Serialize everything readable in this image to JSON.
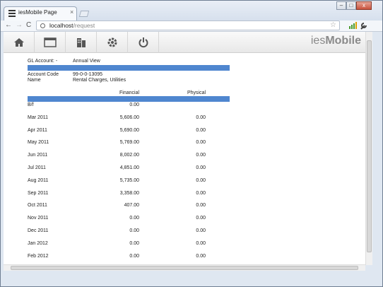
{
  "browser": {
    "tab_title": "iesMobile Page",
    "tab_close": "×",
    "window_controls": {
      "minimize": "–",
      "maximize": "□",
      "close": "x"
    },
    "url_host": "localhost",
    "url_path": "/request",
    "nav": {
      "back": "←",
      "forward": "→",
      "reload": "C"
    },
    "star": "☆"
  },
  "app": {
    "brand_prefix": "ies",
    "brand_suffix": "Mobile"
  },
  "report": {
    "gl_label": "GL Account: -",
    "gl_view": "Annual View",
    "account_code_label": "Account Code",
    "account_code": "99-0-0-13095",
    "name_label": "Name",
    "name": "Rental Charges, Utilities",
    "col_financial": "Financial",
    "col_physical": "Physical",
    "rows": [
      {
        "period": "B/f",
        "financial": "0.00",
        "physical": ""
      },
      {
        "period": "Mar 2011",
        "financial": "5,606.00",
        "physical": "0.00"
      },
      {
        "period": "Apr 2011",
        "financial": "5,690.00",
        "physical": "0.00"
      },
      {
        "period": "May 2011",
        "financial": "5,769.00",
        "physical": "0.00"
      },
      {
        "period": "Jun 2011",
        "financial": "8,002.00",
        "physical": "0.00"
      },
      {
        "period": "Jul 2011",
        "financial": "4,851.00",
        "physical": "0.00"
      },
      {
        "period": "Aug 2011",
        "financial": "5,735.00",
        "physical": "0.00"
      },
      {
        "period": "Sep 2011",
        "financial": "3,358.00",
        "physical": "0.00"
      },
      {
        "period": "Oct 2011",
        "financial": "407.00",
        "physical": "0.00"
      },
      {
        "period": "Nov 2011",
        "financial": "0.00",
        "physical": "0.00"
      },
      {
        "period": "Dec 2011",
        "financial": "0.00",
        "physical": "0.00"
      },
      {
        "period": "Jan 2012",
        "financial": "0.00",
        "physical": "0.00"
      },
      {
        "period": "Feb 2012",
        "financial": "0.00",
        "physical": "0.00"
      }
    ]
  },
  "colors": {
    "accent_bar": "#4f86cf",
    "brand_gray": "#8a8a8a"
  },
  "icons": [
    "home-icon",
    "window-icon",
    "building-icon",
    "gear-icon",
    "power-icon"
  ]
}
